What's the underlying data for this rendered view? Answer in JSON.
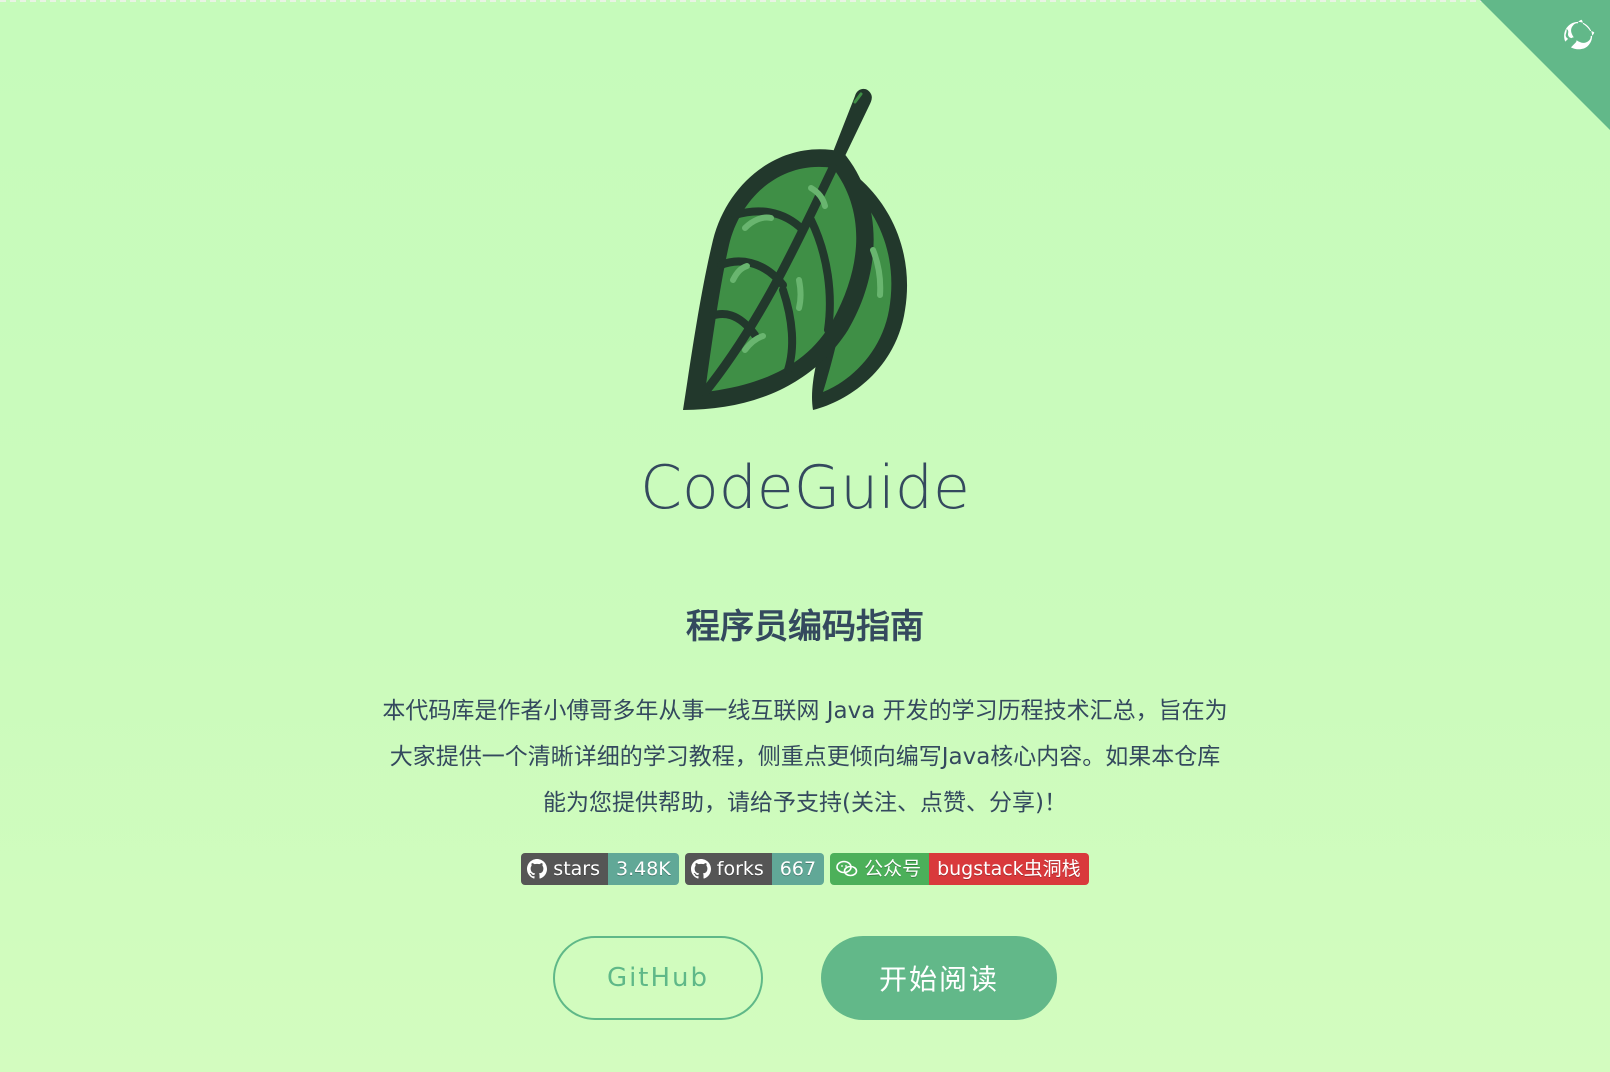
{
  "site": {
    "title": "CodeGuide",
    "subtitle": "程序员编码指南",
    "description": "本代码库是作者小傅哥多年从事一线互联网 Java 开发的学习历程技术汇总，旨在为大家提供一个清晰详细的学习教程，侧重点更倾向编写Java核心内容。如果本仓库能为您提供帮助，请给予支持(关注、点赞、分享)！"
  },
  "badges": [
    {
      "label": "stars",
      "value": "3.48K",
      "icon": "github-icon"
    },
    {
      "label": "forks",
      "value": "667",
      "icon": "github-icon"
    },
    {
      "label": "公众号",
      "value": "bugstack虫洞栈",
      "icon": "wechat-icon"
    }
  ],
  "buttons": {
    "github_label": "GitHub",
    "read_label": "开始阅读"
  },
  "colors": {
    "background": "#c6fbbb",
    "accent": "#62b889",
    "text": "#34495e",
    "leaf_dark": "#22382c",
    "leaf_green": "#3f8f46"
  }
}
